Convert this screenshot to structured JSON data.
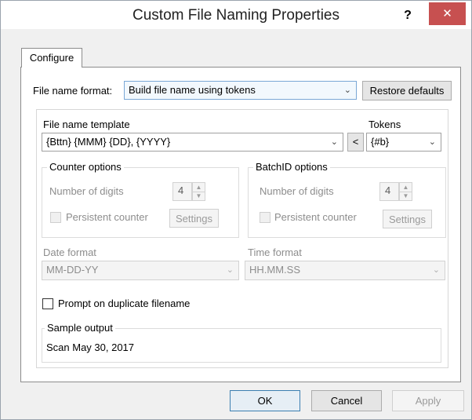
{
  "window": {
    "title": "Custom File Naming Properties",
    "help_glyph": "?",
    "close_glyph": "✕"
  },
  "tabs": [
    {
      "label": "Configure"
    }
  ],
  "format": {
    "label": "File name format:",
    "value": "Build file name using tokens",
    "restore_label": "Restore defaults"
  },
  "template": {
    "label": "File name template",
    "value": "{Bttn} {MMM} {DD}, {YYYY}",
    "insert_label": "<"
  },
  "tokens": {
    "label": "Tokens",
    "value": "{#b}"
  },
  "counter": {
    "title": "Counter options",
    "digits_label": "Number of digits",
    "digits_value": "4",
    "persistent_label": "Persistent counter",
    "settings_label": "Settings"
  },
  "batch": {
    "title": "BatchID options",
    "digits_label": "Number of digits",
    "digits_value": "4",
    "persistent_label": "Persistent counter",
    "settings_label": "Settings"
  },
  "date": {
    "label": "Date format",
    "value": "MM-DD-YY"
  },
  "time": {
    "label": "Time format",
    "value": "HH.MM.SS"
  },
  "prompt_duplicate": {
    "label": "Prompt on duplicate filename",
    "checked": false
  },
  "sample": {
    "title": "Sample output",
    "value": "Scan May 30, 2017"
  },
  "footer": {
    "ok_label": "OK",
    "cancel_label": "Cancel",
    "apply_label": "Apply"
  },
  "glyphs": {
    "chevron": "⌄",
    "spin_up": "▲",
    "spin_down": "▼"
  },
  "colors": {
    "close_button": "#c75050",
    "focus_border": "#3c7fb1"
  }
}
